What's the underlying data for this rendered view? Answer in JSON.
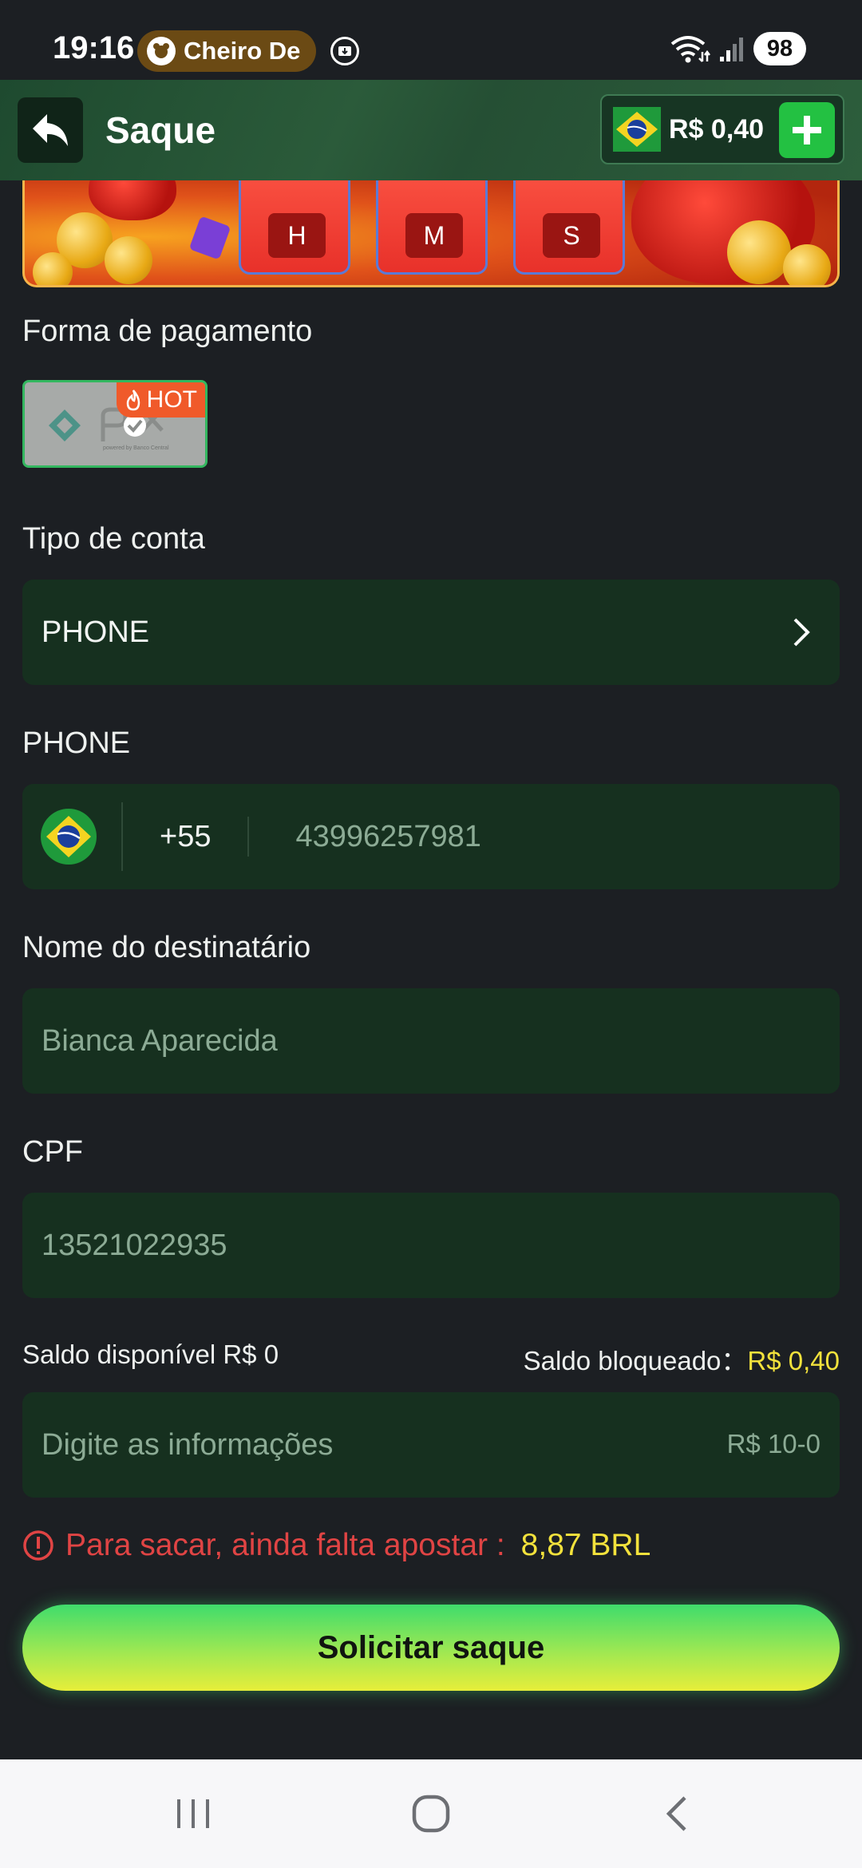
{
  "status_bar": {
    "time": "19:16",
    "notification_text": "Cheiro De",
    "battery": "98"
  },
  "header": {
    "title": "Saque",
    "balance": "R$ 0,40"
  },
  "countdown": {
    "hours_label": "H",
    "minutes_label": "M",
    "seconds_label": "S"
  },
  "form": {
    "payment_method_label": "Forma de pagamento",
    "pix_badge": "HOT",
    "account_type_label": "Tipo de conta",
    "account_type_value": "PHONE",
    "phone_label": "PHONE",
    "country_code": "+55",
    "phone_value": "43996257981",
    "recipient_label": "Nome do destinatário",
    "recipient_value": "Bianca Aparecida",
    "cpf_label": "CPF",
    "cpf_value": "13521022935",
    "available_balance": "Saldo disponível R$ 0",
    "blocked_label": "Saldo bloqueado：",
    "blocked_value": "R$ 0,40",
    "amount_placeholder": "Digite as informações",
    "amount_range": "R$ 10-0",
    "warning_text": "Para sacar, ainda falta apostar :",
    "warning_amount": "8,87 BRL",
    "submit_label": "Solicitar saque"
  },
  "colors": {
    "background": "#1c1f23",
    "field": "#16301f",
    "header": "#2b5b3a",
    "accent_yellow": "#f3e23c",
    "warning_red": "#e04444",
    "button_green": "#3fdc6c"
  }
}
